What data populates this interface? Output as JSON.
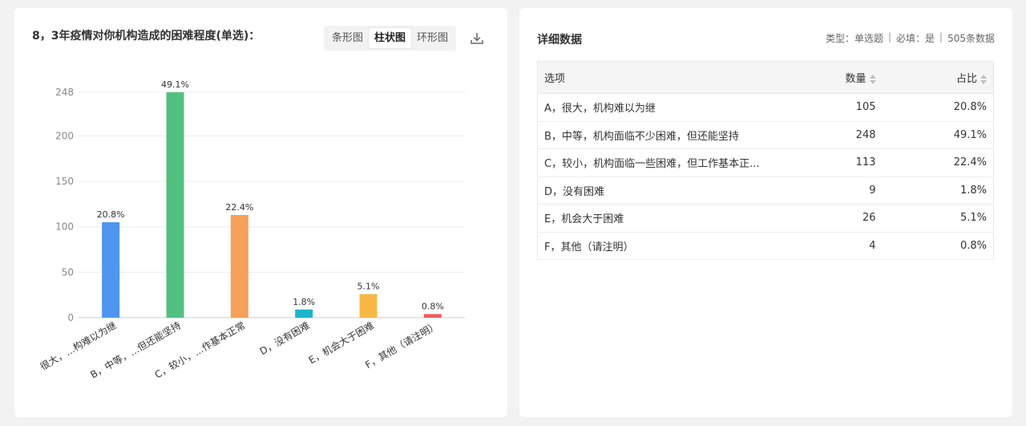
{
  "chart_panel": {
    "title": "8，3年疫情对你机构造成的困难程度(单选)：",
    "toggle": [
      "条形图",
      "柱状图",
      "环形图"
    ],
    "active_toggle": "柱状图",
    "download_icon": "download-icon"
  },
  "chart_data": {
    "type": "bar",
    "categories": [
      "很大，...构难以为继",
      "B，中等，...但还能坚持",
      "C，较小，...作基本正常",
      "D，没有困难",
      "E，机会大于困难",
      "F，其他（请注明）"
    ],
    "values": [
      105,
      248,
      113,
      9,
      26,
      4
    ],
    "data_labels": [
      "20.8%",
      "49.1%",
      "22.4%",
      "1.8%",
      "5.1%",
      "0.8%"
    ],
    "colors": [
      "#4e96f0",
      "#52c080",
      "#f5a05a",
      "#1bb6c9",
      "#f7b843",
      "#ef5b5b"
    ],
    "yticks": [
      "0",
      "50",
      "100",
      "150",
      "200",
      "248"
    ],
    "ylim": [
      0,
      248
    ],
    "grid": true
  },
  "detail": {
    "title": "详细数据",
    "meta": {
      "type": "类型：单选题",
      "required": "必填：是",
      "count": "505条数据",
      "sep": "|"
    },
    "headers": {
      "option": "选项",
      "count": "数量",
      "ratio": "占比"
    },
    "rows": [
      {
        "option": "A，很大，机构难以为继",
        "count": "105",
        "ratio": "20.8%"
      },
      {
        "option": "B，中等，机构面临不少困难，但还能坚持",
        "count": "248",
        "ratio": "49.1%"
      },
      {
        "option": "C，较小，机构面临一些困难，但工作基本正...",
        "count": "113",
        "ratio": "22.4%"
      },
      {
        "option": "D，没有困难",
        "count": "9",
        "ratio": "1.8%"
      },
      {
        "option": "E，机会大于困难",
        "count": "26",
        "ratio": "5.1%"
      },
      {
        "option": "F，其他（请注明）",
        "count": "4",
        "ratio": "0.8%"
      }
    ]
  }
}
